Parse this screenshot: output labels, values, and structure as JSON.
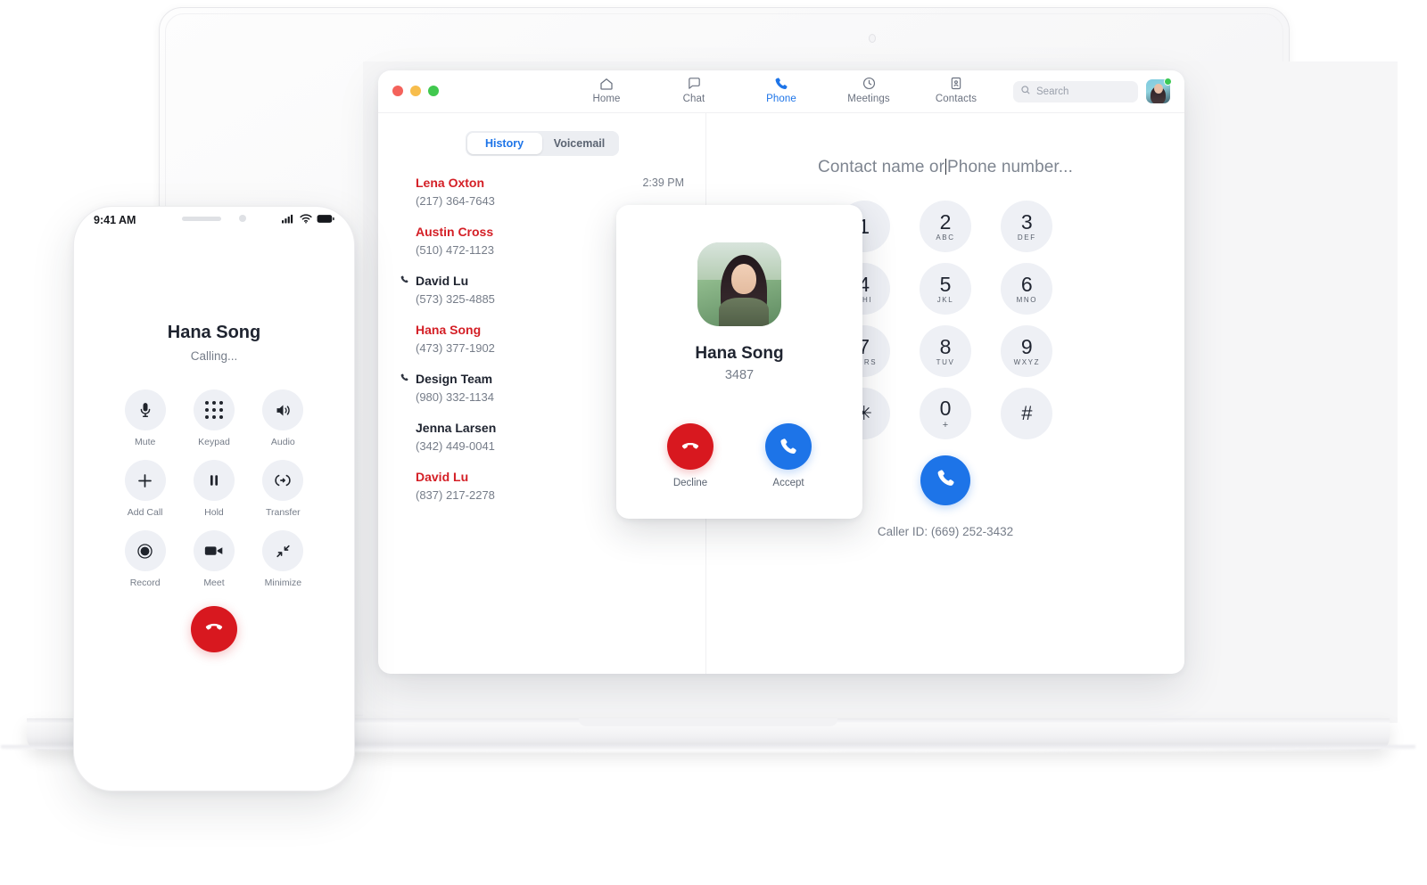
{
  "desktop": {
    "window_controls": [
      "close",
      "minimize",
      "maximize"
    ],
    "nav": [
      {
        "label": "Home",
        "icon": "home-icon",
        "active": false
      },
      {
        "label": "Chat",
        "icon": "chat-bubble-icon",
        "active": false
      },
      {
        "label": "Phone",
        "icon": "phone-icon",
        "active": true
      },
      {
        "label": "Meetings",
        "icon": "clock-icon",
        "active": false
      },
      {
        "label": "Contacts",
        "icon": "contact-card-icon",
        "active": false
      }
    ],
    "search": {
      "placeholder": "Search",
      "icon": "search-icon"
    },
    "avatar": {
      "name": "avatar",
      "status": "online"
    },
    "tabs": {
      "history": "History",
      "voicemail": "Voicemail",
      "active": "History"
    },
    "call_history": [
      {
        "name": "Lena Oxton",
        "number": "(217) 364-7643",
        "missed": true,
        "outgoing": false,
        "time": "2:39 PM"
      },
      {
        "name": "Austin Cross",
        "number": "(510) 472-1123",
        "missed": true,
        "outgoing": false,
        "time": ""
      },
      {
        "name": "David Lu",
        "number": "(573) 325-4885",
        "missed": false,
        "outgoing": true,
        "time": ""
      },
      {
        "name": "Hana Song",
        "number": "(473) 377-1902",
        "missed": true,
        "outgoing": false,
        "time": ""
      },
      {
        "name": "Design Team",
        "number": "(980) 332-1134",
        "missed": false,
        "outgoing": true,
        "time": ""
      },
      {
        "name": "Jenna Larsen",
        "number": "(342) 449-0041",
        "missed": false,
        "outgoing": false,
        "time": ""
      },
      {
        "name": "David Lu",
        "number": "(837) 217-2278",
        "missed": true,
        "outgoing": false,
        "time": ""
      }
    ],
    "dialer": {
      "input_placeholder_left": "Contact name or",
      "input_placeholder_right": "Phone number...",
      "keys": [
        {
          "num": "1",
          "sub": ""
        },
        {
          "num": "2",
          "sub": "ABC"
        },
        {
          "num": "3",
          "sub": "DEF"
        },
        {
          "num": "4",
          "sub": "GHI"
        },
        {
          "num": "5",
          "sub": "JKL"
        },
        {
          "num": "6",
          "sub": "MNO"
        },
        {
          "num": "7",
          "sub": "PQRS"
        },
        {
          "num": "8",
          "sub": "TUV"
        },
        {
          "num": "9",
          "sub": "WXYZ"
        },
        {
          "num": "✳",
          "sub": ""
        },
        {
          "num": "0",
          "sub": "+"
        },
        {
          "num": "#",
          "sub": ""
        }
      ],
      "call_button_icon": "phone-icon",
      "caller_id": "Caller ID: (669) 252-3432"
    },
    "incoming_call": {
      "name": "Hana Song",
      "extension": "3487",
      "photo": "contact-photo",
      "decline_label": "Decline",
      "accept_label": "Accept"
    }
  },
  "mobile": {
    "status_bar": {
      "time": "9:41 AM",
      "icons": [
        "signal-icon",
        "wifi-icon",
        "battery-icon"
      ]
    },
    "call": {
      "name": "Hana Song",
      "state": "Calling..."
    },
    "controls": [
      {
        "label": "Mute",
        "icon": "microphone-icon"
      },
      {
        "label": "Keypad",
        "icon": "keypad-icon"
      },
      {
        "label": "Audio",
        "icon": "speaker-icon"
      },
      {
        "label": "Add Call",
        "icon": "plus-icon"
      },
      {
        "label": "Hold",
        "icon": "pause-icon"
      },
      {
        "label": "Transfer",
        "icon": "transfer-icon"
      },
      {
        "label": "Record",
        "icon": "record-icon"
      },
      {
        "label": "Meet",
        "icon": "video-camera-icon"
      },
      {
        "label": "Minimize",
        "icon": "minimize-icon"
      }
    ],
    "hangup": {
      "icon": "hangup-icon"
    }
  },
  "colors": {
    "accent_blue": "#1d74e8",
    "danger_red": "#d8181f",
    "missed_red": "#d41f26",
    "key_bg": "#eef0f5",
    "muted_text": "#767d89"
  }
}
